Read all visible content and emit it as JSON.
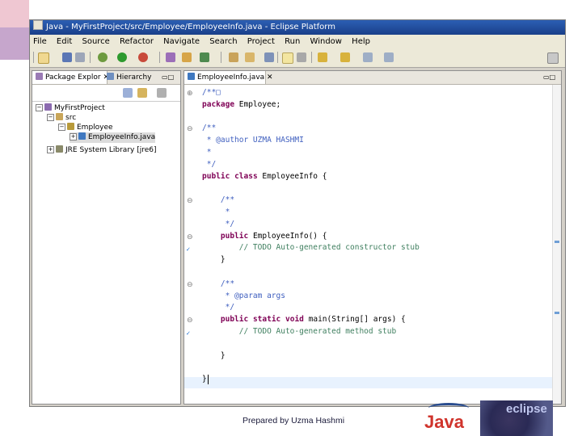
{
  "window": {
    "title": "Java - MyFirstProject/src/Employee/EmployeeInfo.java - Eclipse Platform"
  },
  "menubar": [
    "File",
    "Edit",
    "Source",
    "Refactor",
    "Navigate",
    "Search",
    "Project",
    "Run",
    "Window",
    "Help"
  ],
  "package_explorer": {
    "tabs": [
      "Package Explor",
      "Hierarchy"
    ],
    "tree": [
      {
        "label": "MyFirstProject",
        "expander": "−",
        "icon": "project-icon"
      },
      {
        "label": "src",
        "expander": "−",
        "icon": "source-folder-icon"
      },
      {
        "label": "Employee",
        "expander": "−",
        "icon": "package-icon"
      },
      {
        "label": "EmployeeInfo.java",
        "expander": "+",
        "icon": "java-file-icon"
      },
      {
        "label": "JRE System Library [jre6]",
        "expander": "+",
        "icon": "library-icon"
      }
    ]
  },
  "editor": {
    "tab": "EmployeeInfo.java",
    "lines": [
      {
        "text": "/**□",
        "type": "cm"
      },
      {
        "text": "package Employee;",
        "type": "pkg"
      },
      {
        "text": "",
        "type": "blank"
      },
      {
        "text": "/**",
        "type": "cm"
      },
      {
        "text": " * @author UZMA HASHMI",
        "type": "cm"
      },
      {
        "text": " *",
        "type": "cm"
      },
      {
        "text": " */",
        "type": "cm"
      },
      {
        "text": "public class EmployeeInfo {",
        "type": "class"
      },
      {
        "text": "",
        "type": "blank"
      },
      {
        "text": "    /**",
        "type": "cm"
      },
      {
        "text": "     *",
        "type": "cm"
      },
      {
        "text": "     */",
        "type": "cm"
      },
      {
        "text": "    public EmployeeInfo() {",
        "type": "ctor"
      },
      {
        "text": "        // TODO Auto-generated constructor stub",
        "type": "todo"
      },
      {
        "text": "    }",
        "type": "plain"
      },
      {
        "text": "",
        "type": "blank"
      },
      {
        "text": "    /**",
        "type": "cm"
      },
      {
        "text": "     * @param args",
        "type": "cm"
      },
      {
        "text": "     */",
        "type": "cm"
      },
      {
        "text": "    public static void main(String[] args) {",
        "type": "main"
      },
      {
        "text": "        // TODO Auto-generated method stub",
        "type": "todo"
      },
      {
        "text": "",
        "type": "blank"
      },
      {
        "text": "    }",
        "type": "plain"
      },
      {
        "text": "",
        "type": "blank"
      },
      {
        "text": "}",
        "type": "plain"
      }
    ]
  },
  "footer": {
    "credit": "Prepared by Uzma Hashmi",
    "java_logo_text": "Java",
    "eclipse_logo_text": "eclipse"
  }
}
